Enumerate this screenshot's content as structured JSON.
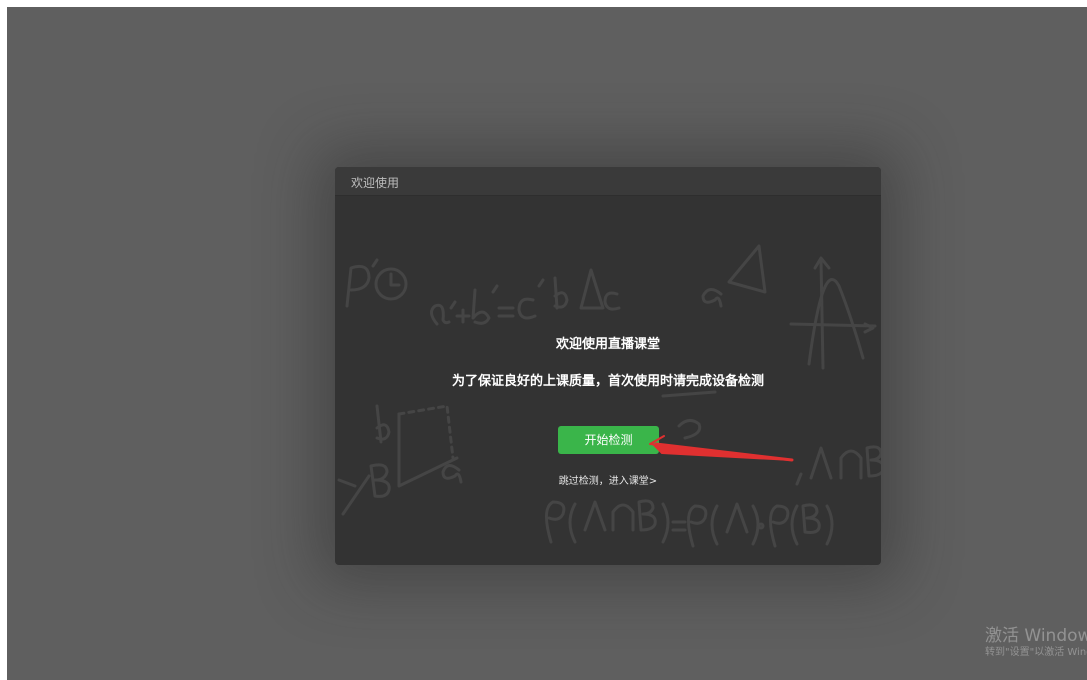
{
  "dialog": {
    "title": "欢迎使用",
    "heading": "欢迎使用直播课堂",
    "subtitle": "为了保证良好的上课质量，首次使用时请完成设备检测",
    "start_button": "开始检测",
    "skip_link": "跳过检测，进入课堂>"
  },
  "watermark": {
    "title": "激活 Windows",
    "subtitle": "转到\"设置\"以激活 Windows。"
  },
  "colors": {
    "backdrop": "#5f5f5f",
    "dialog_background": "#333333",
    "accent_green": "#3ab54a",
    "annotation_arrow": "#e03030"
  },
  "icons": {
    "background_decoration": "math-doodle-background",
    "annotation": "red-arrow-annotation"
  }
}
